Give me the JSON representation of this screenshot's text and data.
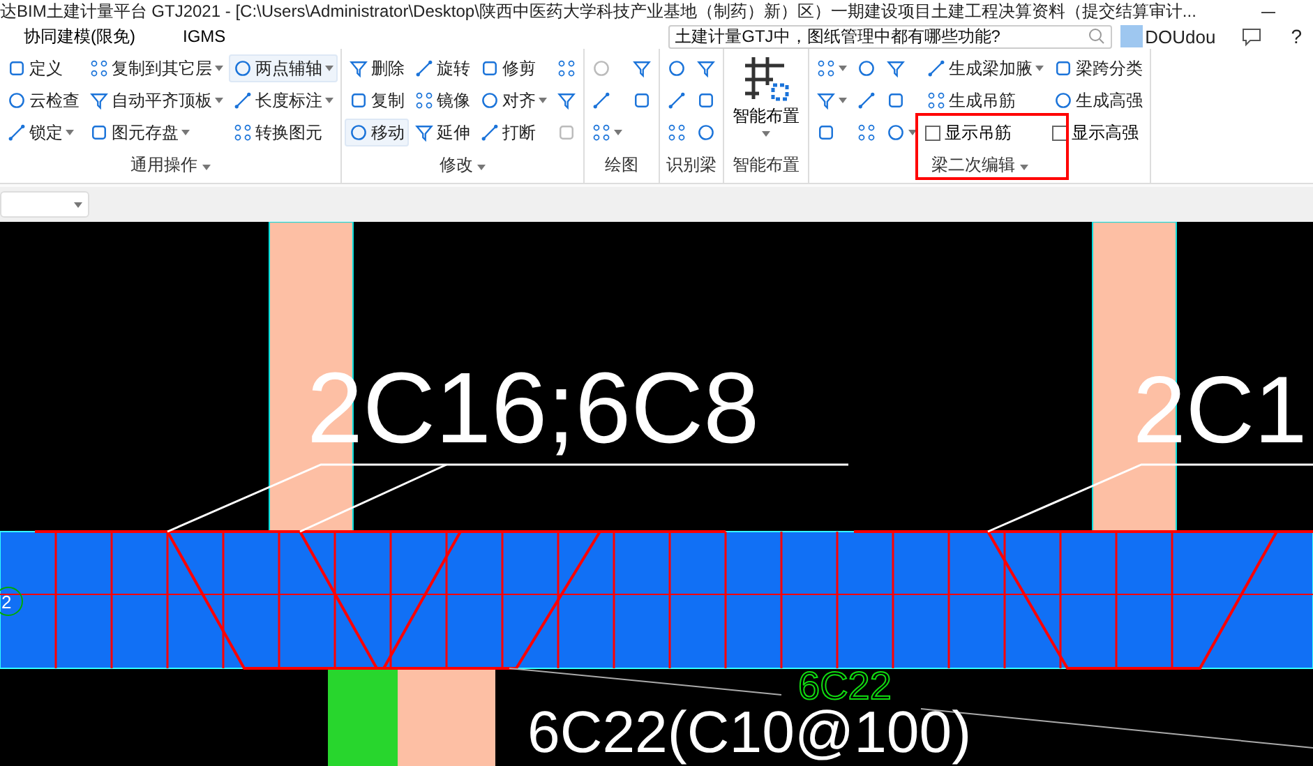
{
  "window": {
    "title": "达BIM土建计量平台 GTJ2021 - [C:\\Users\\Administrator\\Desktop\\陕西中医药大学科技产业基地（制药）新）区）一期建设项目土建工程决算资料（提交结算审计..."
  },
  "menu": {
    "tabs": [
      {
        "label": "协同建模(限免)"
      },
      {
        "label": "IGMS"
      }
    ],
    "search": {
      "placeholder": "土建计量GTJ中，图纸管理中都有哪些功能?"
    },
    "user": {
      "name": "DOUdou"
    },
    "help": "?"
  },
  "ribbon": {
    "groups": [
      {
        "label": "通用操作",
        "dropdown": true,
        "columns": [
          [
            {
              "kind": "text",
              "label": "定义",
              "dropdown": false,
              "highlighted": false
            },
            {
              "kind": "text",
              "label": "云检查",
              "dropdown": false,
              "highlighted": false
            },
            {
              "kind": "text",
              "label": "锁定",
              "dropdown": true,
              "highlighted": false
            }
          ],
          [
            {
              "kind": "text",
              "label": "复制到其它层",
              "dropdown": true,
              "highlighted": false
            },
            {
              "kind": "text",
              "label": "自动平齐顶板",
              "dropdown": true,
              "highlighted": false
            },
            {
              "kind": "text",
              "label": "图元存盘",
              "dropdown": true,
              "highlighted": false
            }
          ],
          [
            {
              "kind": "text",
              "label": "两点辅轴",
              "dropdown": true,
              "highlighted": true
            },
            {
              "kind": "text",
              "label": "长度标注",
              "dropdown": true,
              "highlighted": false
            },
            {
              "kind": "text",
              "label": "转换图元",
              "dropdown": false,
              "highlighted": false
            }
          ]
        ]
      },
      {
        "label": "修改",
        "dropdown": true,
        "columns": [
          [
            {
              "kind": "text",
              "label": "删除",
              "dropdown": false,
              "highlighted": false
            },
            {
              "kind": "text",
              "label": "复制",
              "dropdown": false,
              "highlighted": false
            },
            {
              "kind": "text",
              "label": "移动",
              "dropdown": false,
              "highlighted": true
            }
          ],
          [
            {
              "kind": "text",
              "label": "旋转",
              "dropdown": false,
              "highlighted": false
            },
            {
              "kind": "text",
              "label": "镜像",
              "dropdown": false,
              "highlighted": false
            },
            {
              "kind": "text",
              "label": "延伸",
              "dropdown": false,
              "highlighted": false
            }
          ],
          [
            {
              "kind": "text",
              "label": "修剪",
              "dropdown": false,
              "highlighted": false
            },
            {
              "kind": "text",
              "label": "对齐",
              "dropdown": true,
              "highlighted": false
            },
            {
              "kind": "text",
              "label": "打断",
              "dropdown": false,
              "highlighted": false
            }
          ],
          [
            {
              "kind": "icon",
              "dropdown": false,
              "disabled": false
            },
            {
              "kind": "icon",
              "dropdown": false,
              "disabled": false
            },
            {
              "kind": "icon",
              "dropdown": false,
              "disabled": true
            }
          ]
        ]
      },
      {
        "label": "绘图",
        "dropdown": false,
        "columns": [
          [
            {
              "kind": "icon",
              "dropdown": false,
              "disabled": true
            },
            {
              "kind": "icon",
              "dropdown": false,
              "disabled": false
            },
            {
              "kind": "icon",
              "dropdown": true,
              "disabled": false
            }
          ],
          [
            {
              "kind": "icon",
              "dropdown": false,
              "disabled": false
            },
            {
              "kind": "icon",
              "dropdown": false,
              "disabled": false
            }
          ]
        ]
      },
      {
        "label": "识别梁",
        "dropdown": false,
        "columns": [
          [
            {
              "kind": "icon",
              "dropdown": false,
              "disabled": false
            },
            {
              "kind": "icon",
              "dropdown": false,
              "disabled": false
            },
            {
              "kind": "icon",
              "dropdown": false,
              "disabled": false
            }
          ],
          [
            {
              "kind": "icon",
              "dropdown": false,
              "disabled": false
            },
            {
              "kind": "icon",
              "dropdown": false,
              "disabled": false
            },
            {
              "kind": "icon",
              "dropdown": false,
              "disabled": false
            }
          ]
        ]
      },
      {
        "label": "智能布置",
        "dropdown": false,
        "columns": [
          [
            {
              "kind": "large",
              "label": "智能布置",
              "dropdown": true
            }
          ]
        ]
      },
      {
        "label": "梁二次编辑",
        "dropdown": true,
        "columns": [
          [
            {
              "kind": "icon",
              "dropdown": true,
              "disabled": false
            },
            {
              "kind": "icon",
              "dropdown": true,
              "disabled": false
            },
            {
              "kind": "icon",
              "dropdown": false,
              "disabled": false
            }
          ],
          [
            {
              "kind": "icon",
              "dropdown": false,
              "disabled": false
            },
            {
              "kind": "icon",
              "dropdown": false,
              "disabled": false
            },
            {
              "kind": "icon",
              "dropdown": false,
              "disabled": false
            }
          ],
          [
            {
              "kind": "icon",
              "dropdown": false,
              "disabled": false
            },
            {
              "kind": "icon",
              "dropdown": false,
              "disabled": false
            },
            {
              "kind": "icon",
              "dropdown": true,
              "disabled": false
            }
          ],
          [
            {
              "kind": "text",
              "label": "生成梁加腋",
              "dropdown": true,
              "highlighted": false
            },
            {
              "kind": "text",
              "label": "生成吊筋",
              "dropdown": false,
              "highlighted": false
            },
            {
              "kind": "checkbox",
              "label": "显示吊筋",
              "checked": false
            }
          ],
          [
            {
              "kind": "text",
              "label": "梁跨分类",
              "dropdown": false,
              "highlighted": false
            },
            {
              "kind": "text",
              "label": "生成高强",
              "dropdown": false,
              "highlighted": false
            },
            {
              "kind": "checkbox",
              "label": "显示高强",
              "checked": false
            }
          ]
        ]
      }
    ]
  },
  "canvas": {
    "labels": [
      {
        "kind": "annotation",
        "text": "2C16;6C8"
      },
      {
        "kind": "annotation",
        "text": "2C1"
      },
      {
        "kind": "outline",
        "text": "6C22"
      },
      {
        "kind": "annotation",
        "text": "6C22(C10@100)"
      }
    ],
    "axis_marker": "2"
  }
}
